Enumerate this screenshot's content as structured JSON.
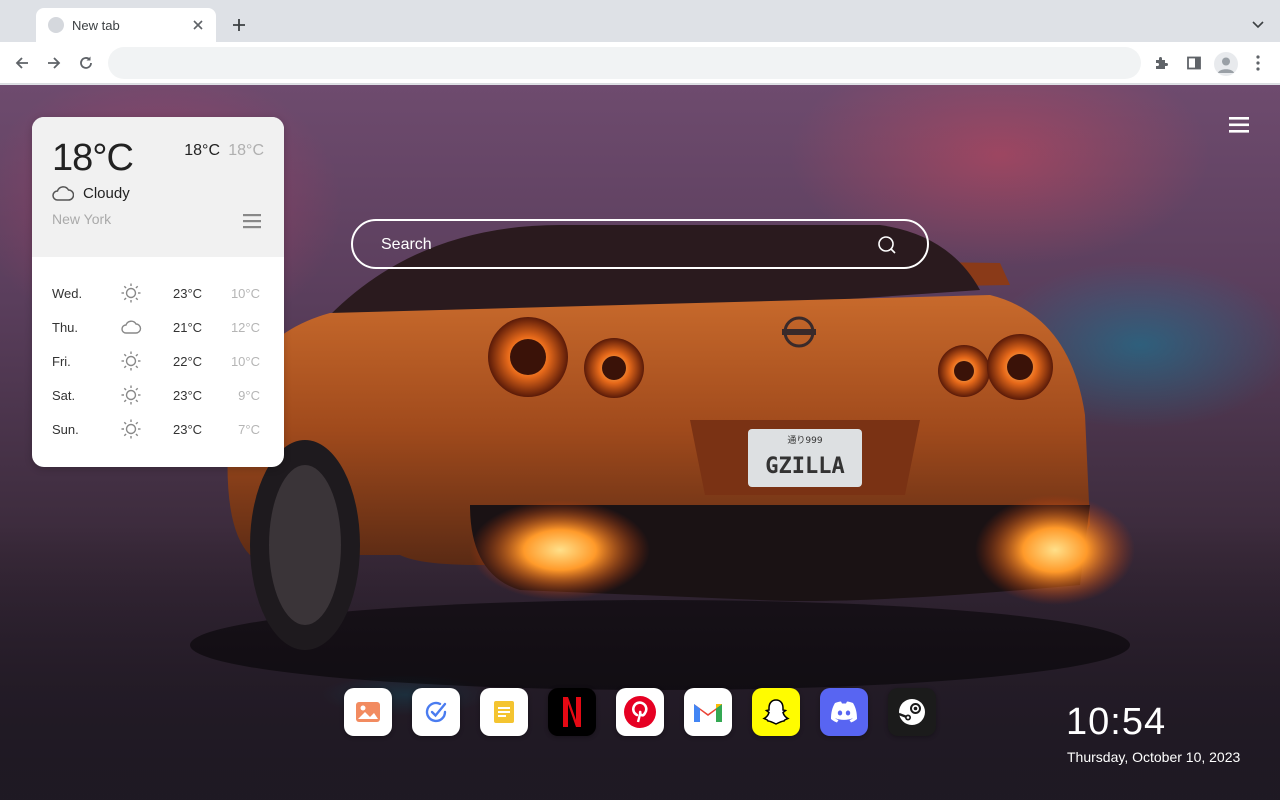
{
  "browser": {
    "tab_title": "New tab",
    "omnibox_value": "",
    "omnibox_placeholder": ""
  },
  "weather": {
    "temperature": "18°C",
    "high": "18°C",
    "low": "18°C",
    "condition": "Cloudy",
    "condition_icon": "cloud-icon",
    "city": "New York",
    "forecast": [
      {
        "day": "Wed.",
        "icon": "sun-icon",
        "high": "23°C",
        "low": "10°C"
      },
      {
        "day": "Thu.",
        "icon": "cloud-icon",
        "high": "21°C",
        "low": "12°C"
      },
      {
        "day": "Fri.",
        "icon": "sun-icon",
        "high": "22°C",
        "low": "10°C"
      },
      {
        "day": "Sat.",
        "icon": "sun-icon",
        "high": "23°C",
        "low": "9°C"
      },
      {
        "day": "Sun.",
        "icon": "sun-icon",
        "high": "23°C",
        "low": "7°C"
      }
    ]
  },
  "search": {
    "placeholder": "Search"
  },
  "wallpaper": {
    "plate_text": "GZILLA",
    "plate_small": "通り999"
  },
  "dock": [
    {
      "name": "photos-app",
      "icon": "image-icon",
      "bg": "#ffffff"
    },
    {
      "name": "tasks-app",
      "icon": "check-circle-icon",
      "bg": "#ffffff"
    },
    {
      "name": "notes-app",
      "icon": "note-icon",
      "bg": "#ffffff"
    },
    {
      "name": "netflix-app",
      "icon": "netflix-icon",
      "bg": "#000000"
    },
    {
      "name": "pinterest-app",
      "icon": "pinterest-icon",
      "bg": "#ffffff"
    },
    {
      "name": "gmail-app",
      "icon": "gmail-icon",
      "bg": "#ffffff"
    },
    {
      "name": "snapchat-app",
      "icon": "snapchat-icon",
      "bg": "#fffc00"
    },
    {
      "name": "discord-app",
      "icon": "discord-icon",
      "bg": "#5865f2"
    },
    {
      "name": "steam-app",
      "icon": "steam-icon",
      "bg": "#1b1b1b"
    }
  ],
  "clock": {
    "time": "10:54",
    "date": "Thursday, October 10, 2023"
  }
}
